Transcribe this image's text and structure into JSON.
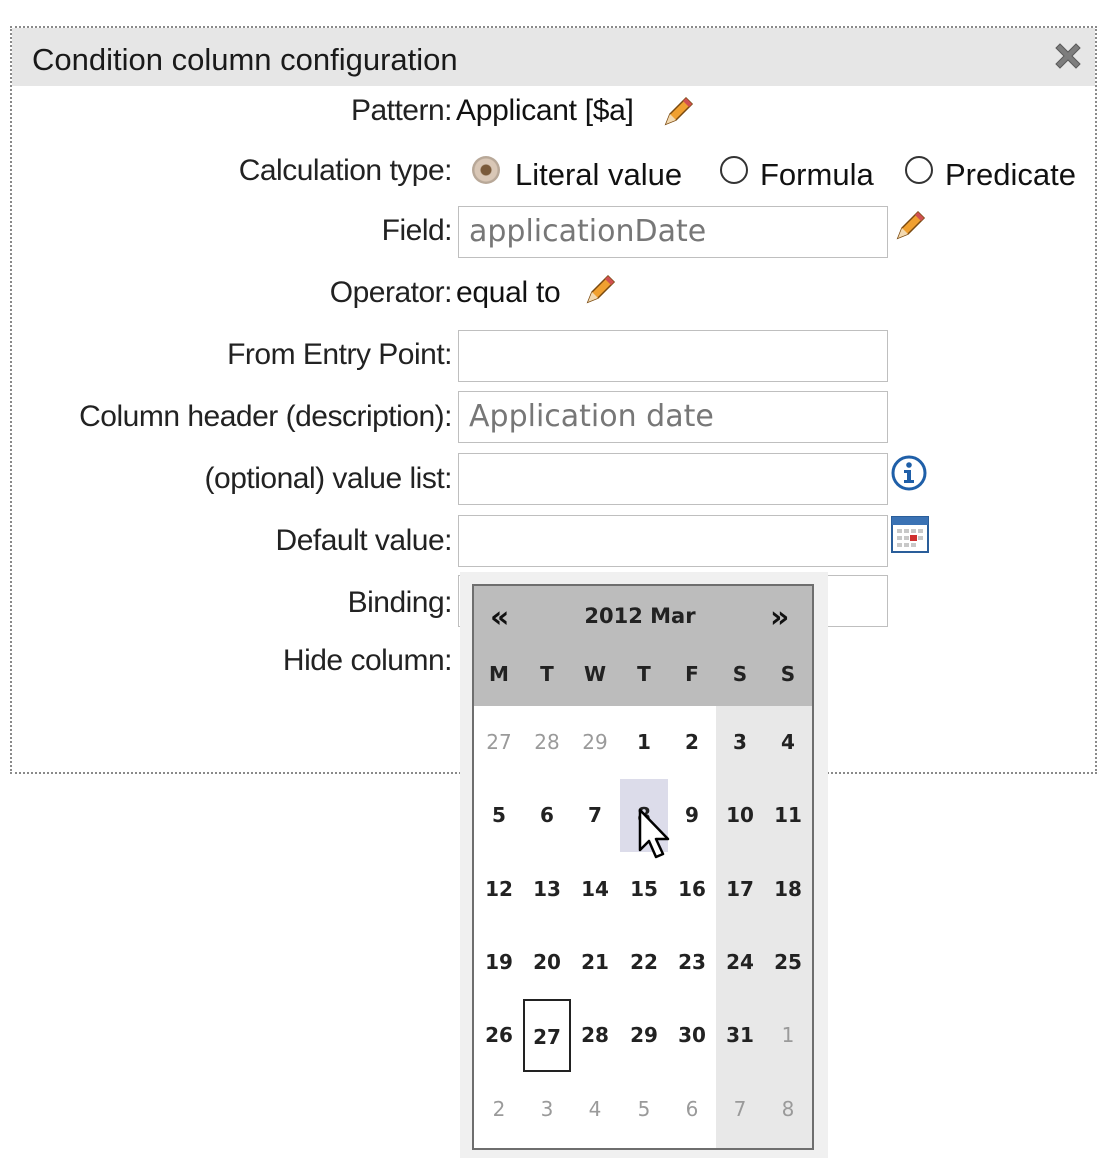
{
  "dialog": {
    "title": "Condition column configuration",
    "close_icon": "close-x-icon"
  },
  "form": {
    "pattern_label": "Pattern:",
    "pattern_value": "Applicant [$a]",
    "calc_label": "Calculation type:",
    "calc_options": [
      "Literal value",
      "Formula",
      "Predicate"
    ],
    "calc_selected": "Literal value",
    "field_label": "Field:",
    "field_value": "applicationDate",
    "operator_label": "Operator:",
    "operator_value": "equal to",
    "entry_point_label": "From Entry Point:",
    "entry_point_value": "",
    "header_label": "Column header (description):",
    "header_value": "Application date",
    "value_list_label": "(optional) value list:",
    "value_list_value": "",
    "default_label": "Default value:",
    "default_value": "",
    "binding_label": "Binding:",
    "hide_label": "Hide column:"
  },
  "calendar": {
    "prev": "«",
    "next": "»",
    "month_label": "2012 Mar",
    "weekdays": [
      "M",
      "T",
      "W",
      "T",
      "F",
      "S",
      "S"
    ],
    "weeks": [
      [
        "27",
        "28",
        "29",
        "1",
        "2",
        "3",
        "4"
      ],
      [
        "5",
        "6",
        "7",
        "8",
        "9",
        "10",
        "11"
      ],
      [
        "12",
        "13",
        "14",
        "15",
        "16",
        "17",
        "18"
      ],
      [
        "19",
        "20",
        "21",
        "22",
        "23",
        "24",
        "25"
      ],
      [
        "26",
        "27",
        "28",
        "29",
        "30",
        "31",
        "1"
      ],
      [
        "2",
        "3",
        "4",
        "5",
        "6",
        "7",
        "8"
      ]
    ],
    "today": "27",
    "hovered": "8"
  },
  "colors": {
    "header_bg": "#bcbcbc",
    "hover_bg": "#dcdcea",
    "weekend_bg": "#e8e8e8",
    "accent_blue": "#1f5fa8"
  }
}
